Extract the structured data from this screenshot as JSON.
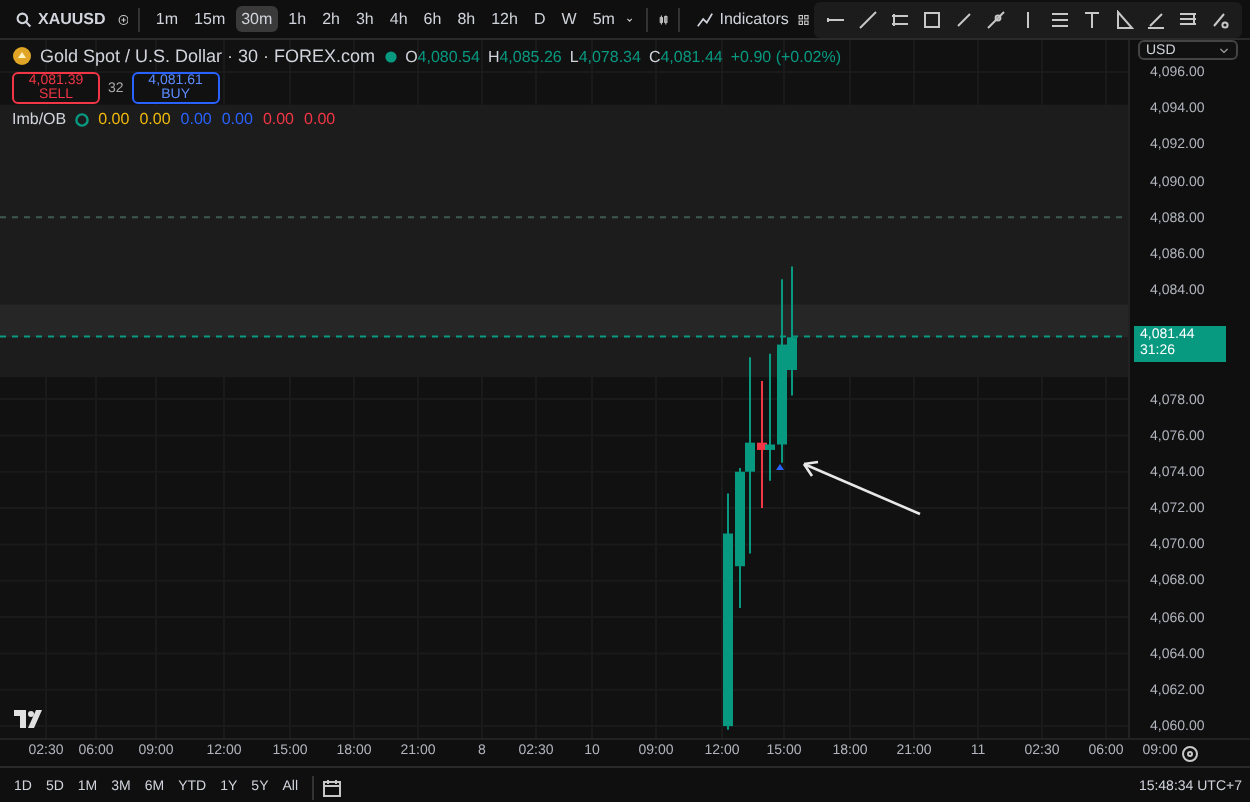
{
  "toolbar": {
    "symbol": "XAUUSD",
    "intervals": [
      {
        "label": "1m",
        "selected": false
      },
      {
        "label": "15m",
        "selected": false
      },
      {
        "label": "30m",
        "selected": true
      },
      {
        "label": "1h",
        "selected": false
      },
      {
        "label": "2h",
        "selected": false
      },
      {
        "label": "3h",
        "selected": false
      },
      {
        "label": "4h",
        "selected": false
      },
      {
        "label": "6h",
        "selected": false
      },
      {
        "label": "8h",
        "selected": false
      },
      {
        "label": "12h",
        "selected": false
      },
      {
        "label": "D",
        "selected": false
      },
      {
        "label": "W",
        "selected": false
      },
      {
        "label": "5m",
        "selected": false
      }
    ],
    "indicators_label": "Indicators"
  },
  "legend": {
    "title": "Gold Spot / U.S. Dollar · 30 · FOREX.com",
    "ohlc": [
      {
        "key": "O",
        "value": "4,080.54"
      },
      {
        "key": "H",
        "value": "4,085.26"
      },
      {
        "key": "L",
        "value": "4,078.34"
      },
      {
        "key": "C",
        "value": "4,081.44"
      }
    ],
    "change": "+0.90 (+0.02%)"
  },
  "trade": {
    "sell_price": "4,081.39",
    "sell_label": "SELL",
    "spread": "32",
    "buy_price": "4,081.61",
    "buy_label": "BUY"
  },
  "indicator": {
    "name": "Imb/OB",
    "values": [
      {
        "text": "0.00",
        "color": "#f0b90b"
      },
      {
        "text": "0.00",
        "color": "#f0b90b"
      },
      {
        "text": "0.00",
        "color": "#2962ff"
      },
      {
        "text": "0.00",
        "color": "#2962ff"
      },
      {
        "text": "0.00",
        "color": "#f23645"
      },
      {
        "text": "0.00",
        "color": "#f23645"
      }
    ]
  },
  "price_axis": {
    "currency": "USD",
    "labels": [
      "4,096.00",
      "4,094.00",
      "4,092.00",
      "4,090.00",
      "4,088.00",
      "4,086.00",
      "4,084.00",
      "4,078.00",
      "4,076.00",
      "4,074.00",
      "4,072.00",
      "4,070.00",
      "4,068.00",
      "4,066.00",
      "4,064.00",
      "4,062.00",
      "4,060.00"
    ],
    "last_price": "4,081.44",
    "countdown": "31:26"
  },
  "time_axis": {
    "labels": [
      "02:30",
      "06:00",
      "09:00",
      "12:00",
      "15:00",
      "18:00",
      "21:00",
      "8",
      "02:30",
      "10",
      "09:00",
      "12:00",
      "15:00",
      "18:00",
      "21:00",
      "11",
      "02:30",
      "06:00",
      "09:00"
    ]
  },
  "range_bar": {
    "ranges": [
      "1D",
      "5D",
      "1M",
      "3M",
      "6M",
      "YTD",
      "1Y",
      "5Y",
      "All"
    ],
    "clock": "15:48:34 UTC+7"
  }
}
